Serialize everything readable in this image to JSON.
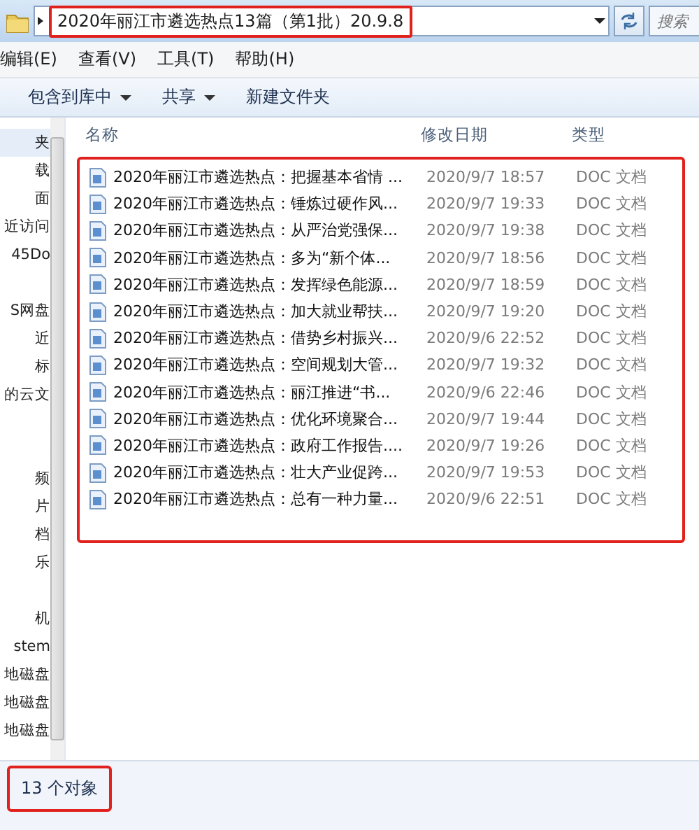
{
  "address_bar": {
    "path": "2020年丽江市遴选热点13篇（第1批）20.9.8",
    "highlighted": true,
    "search_placeholder": "搜索"
  },
  "menu_bar": [
    "编辑(E)",
    "查看(V)",
    "工具(T)",
    "帮助(H)"
  ],
  "toolbar": [
    {
      "label": "包含到库中",
      "has_dropdown": true
    },
    {
      "label": "共享",
      "has_dropdown": true
    },
    {
      "label": "新建文件夹",
      "has_dropdown": false
    }
  ],
  "sidebar": {
    "items": [
      {
        "kind": "item",
        "label": "夹",
        "selected": true
      },
      {
        "kind": "item",
        "label": "载",
        "selected": false
      },
      {
        "kind": "item",
        "label": "面",
        "selected": false
      },
      {
        "kind": "item",
        "label": "近访问",
        "selected": false
      },
      {
        "kind": "item",
        "label": "45Do",
        "selected": false
      },
      {
        "kind": "spacer"
      },
      {
        "kind": "item",
        "label": "S网盘",
        "selected": false
      },
      {
        "kind": "item",
        "label": "近",
        "selected": false
      },
      {
        "kind": "item",
        "label": "标",
        "selected": false
      },
      {
        "kind": "item",
        "label": "的云文",
        "selected": false
      },
      {
        "kind": "spacer"
      },
      {
        "kind": "spacer"
      },
      {
        "kind": "item",
        "label": "频",
        "selected": false
      },
      {
        "kind": "item",
        "label": "片",
        "selected": false
      },
      {
        "kind": "item",
        "label": "档",
        "selected": false
      },
      {
        "kind": "item",
        "label": "乐",
        "selected": false
      },
      {
        "kind": "spacer"
      },
      {
        "kind": "item",
        "label": "机",
        "selected": false
      },
      {
        "kind": "item",
        "label": "stem",
        "selected": false
      },
      {
        "kind": "item",
        "label": "地磁盘",
        "selected": false
      },
      {
        "kind": "item",
        "label": "地磁盘",
        "selected": false
      },
      {
        "kind": "item",
        "label": "地磁盘",
        "selected": false
      }
    ]
  },
  "file_list": {
    "columns": [
      "名称",
      "修改日期",
      "类型"
    ],
    "highlighted": true,
    "rows": [
      {
        "name": "2020年丽江市遴选热点：把握基本省情 ...",
        "modified": "2020/9/7 18:57",
        "type": "DOC 文档"
      },
      {
        "name": "2020年丽江市遴选热点：锤炼过硬作风...",
        "modified": "2020/9/7 19:33",
        "type": "DOC 文档"
      },
      {
        "name": "2020年丽江市遴选热点：从严治党强保...",
        "modified": "2020/9/7 19:38",
        "type": "DOC 文档"
      },
      {
        "name": "2020年丽江市遴选热点：多为“新个体...",
        "modified": "2020/9/7 18:56",
        "type": "DOC 文档"
      },
      {
        "name": "2020年丽江市遴选热点：发挥绿色能源...",
        "modified": "2020/9/7 18:59",
        "type": "DOC 文档"
      },
      {
        "name": "2020年丽江市遴选热点：加大就业帮扶...",
        "modified": "2020/9/7 19:20",
        "type": "DOC 文档"
      },
      {
        "name": "2020年丽江市遴选热点：借势乡村振兴...",
        "modified": "2020/9/6 22:52",
        "type": "DOC 文档"
      },
      {
        "name": "2020年丽江市遴选热点：空间规划大管...",
        "modified": "2020/9/7 19:32",
        "type": "DOC 文档"
      },
      {
        "name": "2020年丽江市遴选热点：丽江推进“书...",
        "modified": "2020/9/6 22:46",
        "type": "DOC 文档"
      },
      {
        "name": "2020年丽江市遴选热点：优化环境聚合...",
        "modified": "2020/9/7 19:44",
        "type": "DOC 文档"
      },
      {
        "name": "2020年丽江市遴选热点：政府工作报告....",
        "modified": "2020/9/7 19:26",
        "type": "DOC 文档"
      },
      {
        "name": "2020年丽江市遴选热点：壮大产业促跨...",
        "modified": "2020/9/7 19:53",
        "type": "DOC 文档"
      },
      {
        "name": "2020年丽江市遴选热点：总有一种力量...",
        "modified": "2020/9/6 22:51",
        "type": "DOC 文档"
      }
    ]
  },
  "status_bar": {
    "text": "13 个对象",
    "highlighted": true
  }
}
